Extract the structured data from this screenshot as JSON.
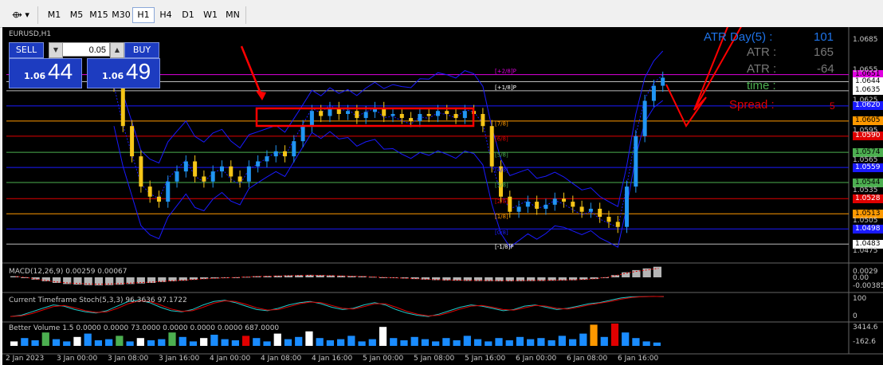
{
  "toolbar": {
    "timeframes": [
      "M1",
      "M5",
      "M15",
      "M30",
      "H1",
      "H4",
      "D1",
      "W1",
      "MN"
    ],
    "active_timeframe": "H1"
  },
  "chart": {
    "symbol": "EURUSD,H1",
    "trade_panel": {
      "sell_label": "SELL",
      "buy_label": "BUY",
      "lot_value": "0.05",
      "sell_price_small": "1.06",
      "sell_price_big": "44",
      "buy_price_small": "1.06",
      "buy_price_big": "49"
    },
    "atr_panel": {
      "atr_day_label": "ATR Day(5) :",
      "atr_day_value": "101",
      "atr_label": "ATR :",
      "atr_value": "165",
      "atr2_label": "ATR :",
      "atr2_value": "-64",
      "time_label": "time :",
      "spread_label": "Spread :",
      "spread_value": "5"
    },
    "price_labels": [
      {
        "text": "1.0651",
        "bg": "#e000e0",
        "y": 1.0651
      },
      {
        "text": "1.0644",
        "bg": "#ffffff",
        "y": 1.0644
      },
      {
        "text": "1.0635",
        "bg": "#ffffff",
        "y": 1.0635
      },
      {
        "text": "1.0620",
        "bg": "#1a1aff",
        "y": 1.062
      },
      {
        "text": "1.0605",
        "bg": "#ff9900",
        "y": 1.0605
      },
      {
        "text": "1.0590",
        "bg": "#e00000",
        "y": 1.059
      },
      {
        "text": "1.0574",
        "bg": "#4caf50",
        "y": 1.0574
      },
      {
        "text": "1.0559",
        "bg": "#1a1aff",
        "y": 1.0559
      },
      {
        "text": "1.0544",
        "bg": "#4caf50",
        "y": 1.0544
      },
      {
        "text": "1.0528",
        "bg": "#e00000",
        "y": 1.0528
      },
      {
        "text": "1.0513",
        "bg": "#ff9900",
        "y": 1.0513
      },
      {
        "text": "1.0498",
        "bg": "#1a1aff",
        "y": 1.0498
      },
      {
        "text": "1.0483",
        "bg": "#ffffff",
        "y": 1.0483
      }
    ],
    "axis_ticks": [
      "1.0685",
      "1.0655",
      "1.0625",
      "1.0595",
      "1.0565",
      "1.0535",
      "1.0505",
      "1.0475"
    ],
    "murrey_labels": [
      {
        "text": "[+2/8]P",
        "y": 1.0651,
        "color": "#e000e0"
      },
      {
        "text": "[+1/8]P",
        "y": 1.0635,
        "color": "#ffffff"
      },
      {
        "text": "[7/8]",
        "y": 1.0599,
        "color": "#ff9900"
      },
      {
        "text": "[6/8]",
        "y": 1.0584,
        "color": "#e00000"
      },
      {
        "text": "[5/8]",
        "y": 1.0568,
        "color": "#4caf50"
      },
      {
        "text": "[4/8]",
        "y": 1.0553,
        "color": "#1a1aff"
      },
      {
        "text": "[3/8]",
        "y": 1.0538,
        "color": "#4caf50"
      },
      {
        "text": "[2/8]",
        "y": 1.0522,
        "color": "#e00000"
      },
      {
        "text": "[1/8]",
        "y": 1.0507,
        "color": "#ff9900"
      },
      {
        "text": "[0/8]",
        "y": 1.0491,
        "color": "#1a1aff"
      },
      {
        "text": "[-1/8]P",
        "y": 1.0477,
        "color": "#ffffff"
      }
    ],
    "macd": {
      "title": "MACD(12,26,9) 0.00259 0.00067",
      "ticks": [
        "0.0029",
        "0.00",
        "-0.00385"
      ],
      "values": [
        0.1,
        0.0,
        -0.2,
        -0.35,
        -0.5,
        -0.6,
        -0.65,
        -0.7,
        -0.72,
        -0.7,
        -0.66,
        -0.6,
        -0.55,
        -0.5,
        -0.42,
        -0.35,
        -0.3,
        -0.22,
        -0.15,
        -0.1,
        -0.05,
        0.0,
        0.05,
        0.1,
        0.12,
        0.15,
        0.18,
        0.2,
        0.22,
        0.2,
        0.18,
        0.15,
        0.12,
        0.1,
        0.05,
        0.0,
        -0.05,
        -0.1,
        -0.15,
        -0.2,
        -0.25,
        -0.28,
        -0.3,
        -0.32,
        -0.33,
        -0.34,
        -0.35,
        -0.35,
        -0.34,
        -0.33,
        -0.32,
        -0.3,
        -0.28,
        -0.26,
        -0.22,
        -0.15,
        0.0,
        0.2,
        0.45,
        0.65,
        0.8,
        0.95
      ]
    },
    "stoch": {
      "title": "Current Timeframe Stoch(5,3,3) 96.3636 97.1722",
      "ticks": [
        "100",
        "0"
      ],
      "k": [
        10,
        15,
        30,
        45,
        60,
        55,
        40,
        30,
        25,
        35,
        55,
        75,
        80,
        70,
        50,
        35,
        30,
        40,
        60,
        75,
        80,
        70,
        55,
        40,
        35,
        45,
        60,
        70,
        75,
        65,
        50,
        40,
        45,
        60,
        70,
        60,
        40,
        25,
        15,
        10,
        20,
        35,
        50,
        60,
        55,
        45,
        35,
        40,
        55,
        60,
        50,
        40,
        45,
        55,
        65,
        70,
        80,
        90,
        95,
        96,
        97,
        96
      ]
    },
    "volume": {
      "title": "Better Volume 1.5 0.0000 0.0000 73.0000 0.0000 0.0000 0.0000 687.0000",
      "ticks": [
        "3414.6",
        "-162.6"
      ],
      "values": [
        20,
        35,
        25,
        60,
        30,
        20,
        40,
        55,
        25,
        30,
        45,
        20,
        35,
        25,
        30,
        60,
        40,
        20,
        35,
        50,
        30,
        25,
        45,
        35,
        20,
        55,
        30,
        40,
        65,
        35,
        25,
        30,
        45,
        20,
        30,
        85,
        35,
        25,
        40,
        30,
        20,
        35,
        25,
        45,
        30,
        20,
        35,
        25,
        40,
        30,
        35,
        25,
        45,
        30,
        55,
        95,
        40,
        100,
        60,
        35,
        20,
        15
      ],
      "colors": [
        "#ffffff",
        "#1a8cff",
        "#1a8cff",
        "#4caf50",
        "#1a8cff",
        "#1a8cff",
        "#ffffff",
        "#1a8cff",
        "#1a8cff",
        "#1a8cff",
        "#4caf50",
        "#1a8cff",
        "#ffffff",
        "#1a8cff",
        "#1a8cff",
        "#4caf50",
        "#1a8cff",
        "#1a8cff",
        "#ffffff",
        "#1a8cff",
        "#1a8cff",
        "#1a8cff",
        "#e00000",
        "#1a8cff",
        "#1a8cff",
        "#ffffff",
        "#1a8cff",
        "#1a8cff",
        "#ffffff",
        "#1a8cff",
        "#1a8cff",
        "#1a8cff",
        "#1a8cff",
        "#1a8cff",
        "#1a8cff",
        "#ffffff",
        "#1a8cff",
        "#1a8cff",
        "#1a8cff",
        "#1a8cff",
        "#1a8cff",
        "#1a8cff",
        "#1a8cff",
        "#1a8cff",
        "#1a8cff",
        "#1a8cff",
        "#1a8cff",
        "#1a8cff",
        "#1a8cff",
        "#1a8cff",
        "#1a8cff",
        "#1a8cff",
        "#1a8cff",
        "#1a8cff",
        "#1a8cff",
        "#ff9900",
        "#1a8cff",
        "#e00000",
        "#1a8cff",
        "#1a8cff",
        "#1a8cff",
        "#1a8cff"
      ]
    },
    "time_labels": [
      "2 Jan 2023",
      "3 Jan 00:00",
      "3 Jan 08:00",
      "3 Jan 16:00",
      "4 Jan 00:00",
      "4 Jan 08:00",
      "4 Jan 16:00",
      "5 Jan 00:00",
      "5 Jan 08:00",
      "5 Jan 16:00",
      "6 Jan 00:00",
      "6 Jan 08:00",
      "6 Jan 16:00"
    ],
    "colors": {
      "background": "#000000",
      "bull_candle": "#2196f3",
      "bear_candle": "#f5c518",
      "bands": "#1a1aff",
      "annotation": "#ff0000"
    }
  },
  "chart_data": {
    "type": "candlestick",
    "symbol": "EURUSD",
    "timeframe": "H1",
    "ylim": [
      1.0465,
      1.0695
    ],
    "closes": [
      1.064,
      1.06,
      1.057,
      1.054,
      1.053,
      1.0525,
      1.0545,
      1.0555,
      1.0565,
      1.055,
      1.0545,
      1.0555,
      1.056,
      1.055,
      1.0545,
      1.056,
      1.0565,
      1.057,
      1.0575,
      1.057,
      1.0585,
      1.06,
      1.0615,
      1.061,
      1.0618,
      1.0612,
      1.0615,
      1.0608,
      1.0614,
      1.0618,
      1.061,
      1.0612,
      1.0608,
      1.0605,
      1.0612,
      1.061,
      1.0615,
      1.0612,
      1.0608,
      1.0615,
      1.0612,
      1.06,
      1.056,
      1.053,
      1.0515,
      1.052,
      1.0525,
      1.0518,
      1.0522,
      1.0528,
      1.0525,
      1.052,
      1.0515,
      1.0518,
      1.051,
      1.0505,
      1.05,
      1.054,
      1.059,
      1.0625,
      1.064,
      1.0648
    ]
  }
}
